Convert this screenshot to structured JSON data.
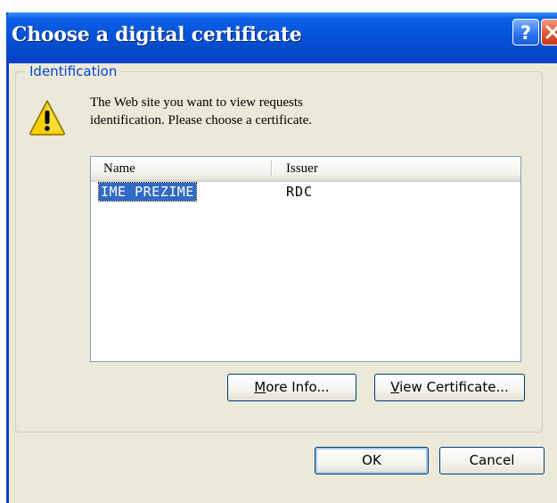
{
  "window": {
    "title": "Choose a digital certificate",
    "titlebar_buttons": [
      {
        "name": "help",
        "icon": "question-mark-icon"
      },
      {
        "name": "close",
        "icon": "close-icon"
      }
    ]
  },
  "group": {
    "legend": "Identification",
    "icon": "warning-icon",
    "message_line1": "The Web site you want to view requests",
    "message_line2": "identification. Please choose a certificate."
  },
  "certificates": {
    "columns": [
      "Name",
      "Issuer"
    ],
    "rows": [
      {
        "name": "IME PREZIME",
        "issuer": "RDC",
        "selected": true
      }
    ]
  },
  "buttons": {
    "more_info": {
      "accel": "M",
      "rest": "ore Info..."
    },
    "view_certificate": {
      "accel": "V",
      "rest": "iew Certificate..."
    },
    "ok": "OK",
    "cancel": "Cancel"
  },
  "colors": {
    "titlebar": "#0453d9",
    "dialog_bg": "#ece9d8",
    "legend_text": "#0046d5",
    "selection": "#316ac5",
    "close_button": "#e2562e"
  }
}
